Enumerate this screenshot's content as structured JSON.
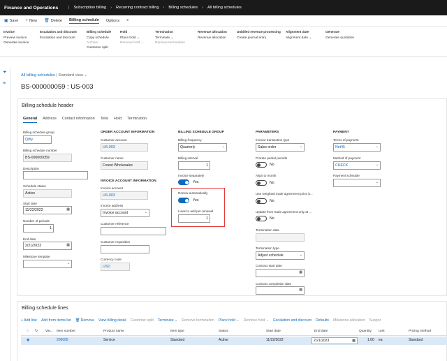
{
  "topbar": {
    "app": "Finance and Operations",
    "crumbs": [
      "Subscription billing",
      "Recurring contract billing",
      "Billing schedules",
      "All billing schedules"
    ]
  },
  "commands": {
    "save": "Save",
    "new": "New",
    "delete": "Delete",
    "tab_active": "Billing schedule",
    "tab_options": "Options"
  },
  "ribbon": [
    {
      "header": "Invoice",
      "items": [
        "Preview invoice",
        "Generate invoice"
      ]
    },
    {
      "header": "Escalation and discount",
      "items": [
        "Escalation and discount"
      ]
    },
    {
      "header": "Billing schedule",
      "items": [
        "Copy schedule",
        "Archive",
        "Customer split"
      ]
    },
    {
      "header": "Hold",
      "items": [
        "Place hold ⌄",
        "Remove hold ⌄"
      ]
    },
    {
      "header": "Termination",
      "items": [
        "Terminate ⌄",
        "Remove termination"
      ]
    },
    {
      "header": "Revenue allocation",
      "items": [
        "Revenue allocation"
      ]
    },
    {
      "header": "Unbilled revenue processing",
      "items": [
        "Create journal entry"
      ]
    },
    {
      "header": "Alignment date",
      "items": [
        "Alignment date ⌄"
      ]
    },
    {
      "header": "Generate",
      "items": [
        "Generate quotation"
      ]
    }
  ],
  "view": {
    "breadcrumb": "All billing schedules",
    "view_name": "Standard view",
    "title": "BS-000000059 : US-003"
  },
  "header_card": {
    "title": "Billing schedule header",
    "tabs": [
      "General",
      "Address",
      "Contact information",
      "Total",
      "Hold",
      "Termination"
    ]
  },
  "col1": {
    "group_label": "Billing schedule group",
    "group_value": "Qrtly",
    "number_label": "Billing schedule number",
    "number_value": "BS-000000059",
    "description_label": "Description",
    "description_value": "",
    "status_label": "Schedule status",
    "status_value": "Active",
    "start_label": "Start date",
    "start_value": "11/22/2022",
    "periods_label": "Number of periods",
    "periods_value": "1",
    "end_label": "End date",
    "end_value": "2/21/2023",
    "milestone_label": "Milestone template",
    "milestone_value": ""
  },
  "col2": {
    "order_heading": "ORDER ACCOUNT INFORMATION",
    "cust_label": "Customer account",
    "cust_value": "US-003",
    "name_label": "Customer name",
    "name_value": "Forest Wholesales",
    "invoice_heading": "INVOICE ACCOUNT INFORMATION",
    "inv_label": "Invoice account",
    "inv_value": "US-003",
    "addr_label": "Invoice address",
    "addr_value": "Invoice account",
    "ref_label": "Customer reference",
    "ref_value": "",
    "req_label": "Customer requisition",
    "req_value": "",
    "cur_label": "Currency code",
    "cur_value": "USD"
  },
  "col3": {
    "heading": "BILLING SCHEDULE GROUP",
    "freq_label": "Billing frequency",
    "freq_value": "Quarterly",
    "interval_label": "Billing interval",
    "interval_value": "1",
    "sep_label": "Invoice separately",
    "sep_value": "Yes",
    "renew_label": "Renew automatically",
    "renew_value": "Yes",
    "lines_label": "Lines to add per renewal",
    "lines_value": "1"
  },
  "col4": {
    "heading": "PARAMETERS",
    "type_label": "Invoice transaction type",
    "type_value": "Sales order",
    "prorate_label": "Prorate partial periods",
    "prorate_value": "No",
    "align_label": "Align to month",
    "align_value": "No",
    "weighted_label": "Use weighted trade agreement price b...",
    "weighted_value": "No",
    "update_label": "Update from trade agreement only at ...",
    "update_value": "No",
    "term_date_label": "Termination date",
    "term_date_value": "",
    "term_type_label": "Termination type",
    "term_type_value": "Adjust schedule",
    "cstart_label": "Contract start date",
    "cstart_value": "",
    "ccomp_label": "Contract completion date",
    "ccomp_value": ""
  },
  "col5": {
    "heading": "PAYMENT",
    "terms_label": "Terms of payment",
    "terms_value": "Net45",
    "method_label": "Method of payment",
    "method_value": "CHECK",
    "sched_label": "Payment schedule",
    "sched_value": ""
  },
  "lines": {
    "title": "Billing schedule lines",
    "toolbar": [
      "+ Add line",
      "Add from items list",
      "🗑 Remove",
      "View billing detail",
      "Customer split",
      "Terminate ⌄",
      "Remove termination",
      "Place hold ⌄",
      "Remove hold ⌄",
      "Escalation and discount",
      "Defaults",
      "Milestone allocation",
      "Suppor"
    ],
    "columns": [
      "Var...",
      "Item number",
      "Product name",
      "Item type",
      "Status",
      "Start date",
      "End date",
      "Quantity",
      "Unit",
      "Pricing method"
    ],
    "row": {
      "item": "200005",
      "product": "Service",
      "type": "Standard",
      "status": "Active",
      "start": "11/22/2022",
      "end": "2/21/2023",
      "qty": "1.00",
      "unit": "ea",
      "pricing": "Standard"
    }
  }
}
